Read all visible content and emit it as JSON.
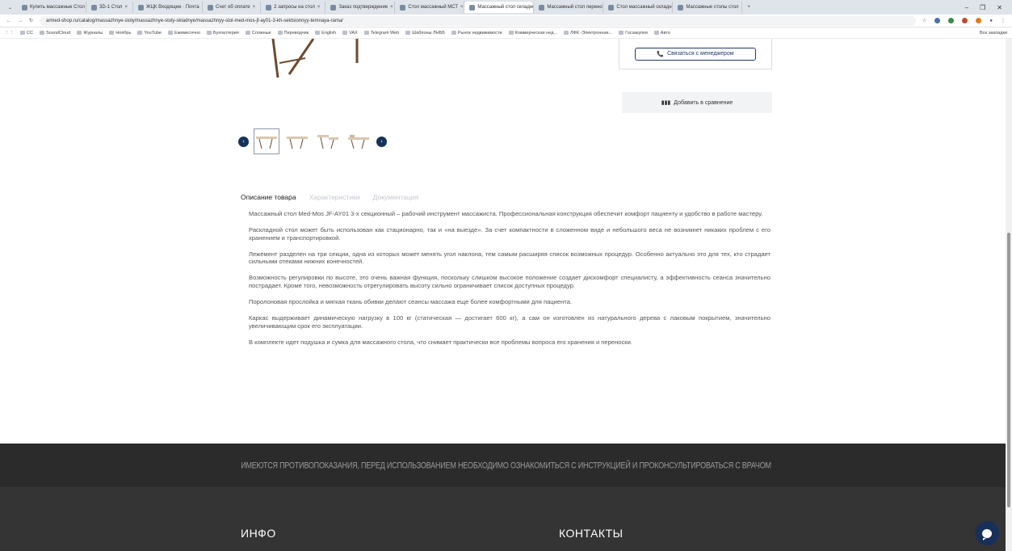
{
  "browser": {
    "tabs": [
      {
        "label": "Купить массажные Стол",
        "active": false
      },
      {
        "label": "3D-1 Стол",
        "active": false
      },
      {
        "label": "ЖЦК Входящие · Почта",
        "active": false
      },
      {
        "label": "Счет об оплате",
        "active": false
      },
      {
        "label": "2 запросы на стол",
        "active": false
      },
      {
        "label": "Заказ подтверждение",
        "active": false
      },
      {
        "label": "Стол массажный МСТ",
        "active": false
      },
      {
        "label": "Массажный стол складной",
        "active": true
      },
      {
        "label": "Массажный стол переносной",
        "active": false
      },
      {
        "label": "Стол массажный складной",
        "active": false
      },
      {
        "label": "Массажные столы стол",
        "active": false
      }
    ],
    "new_tab": "+",
    "window_controls": [
      "–",
      "❐",
      "✕"
    ],
    "url": "armed-shop.ru/catalog/massazhnye-stoly/massazhnye-stoly-skladnye/massazhnyy-stol-med-mos-jf-ay01-3-kh-sektsionnyy-temnaya-rama/",
    "bookmarks": [
      "СС",
      "SoundCloud",
      "Журналы",
      "Ноябрь",
      "YouTube",
      "Ежемесячно",
      "Бухгалтерия",
      "Сложные",
      "Переводчик",
      "English",
      "VAX",
      "Telegram Web",
      "Шаблоны ЛНББ",
      "Рынок недвижимости",
      "Коммерческая нед...",
      "ЛФК -Электронная...",
      "Госзакупки",
      "Авто"
    ],
    "bookmarks_right": "Все закладки"
  },
  "product": {
    "contact_label": "Связаться с менеджером",
    "compare_label": "Добавить в сравнение",
    "tabs": [
      "Описание товара",
      "Характеристики",
      "Документация"
    ],
    "description": [
      "Массажный стол Med-Mos JF-AY01 3-х секционный – рабочий инструмент массажиста. Профессиональная конструкция обеспечит комфорт пациенту и удобство в работе мастеру.",
      "Раскладной стол может быть использован как стационарно, так и «на выезде». За счет компактности в сложенном виде и небольшого веса не возникнет никаких проблем с его хранением и транспортировкой.",
      "Лежемент разделен на три секции, одна из которых может менять угол наклона, тем самым расширяя список возможных процедур. Особенно актуально это для тех, кто страдает сильными отеками нижних конечностей.",
      "Возможность регулировки по высоте, это очень важная функция, поскольку слишком высокое положение создает дискомфорт специалисту, а эффективность сеанса значительно пострадает. Кроме того, невозможность отрегулировать высоту сильно ограничивает список доступных процедур.",
      "Поролоновая прослойка и мягкая ткань обивки делают сеансы массажа еще более комфортными для пациента.",
      "Каркас выдерживает динамическую нагрузку в 100 кг (статическая — достигает 600 кг), а сам он изготовлен из натурального дерева с лаковым покрытием, значительно увеличивающим срок его эксплуатации.",
      "В комплекте идет подушка и сумка для массажного стола, что снимает практически все проблемы вопроса его хранения и переноски."
    ]
  },
  "footer": {
    "warning": "ИМЕЮТСЯ ПРОТИВОПОКАЗАНИЯ, ПЕРЕД ИСПОЛЬЗОВАНИЕМ НЕОБХОДИМО ОЗНАКОМИТЬСЯ С ИНСТРУКЦИЕЙ И ПРОКОНСУЛЬТИРОВАТЬСЯ С ВРАЧОМ",
    "info_title": "ИНФО",
    "contacts_title": "КОНТАКТЫ"
  },
  "colors": {
    "accent": "#16325c",
    "footer_dark": "#2b2b2b",
    "footer_main": "#343434"
  }
}
